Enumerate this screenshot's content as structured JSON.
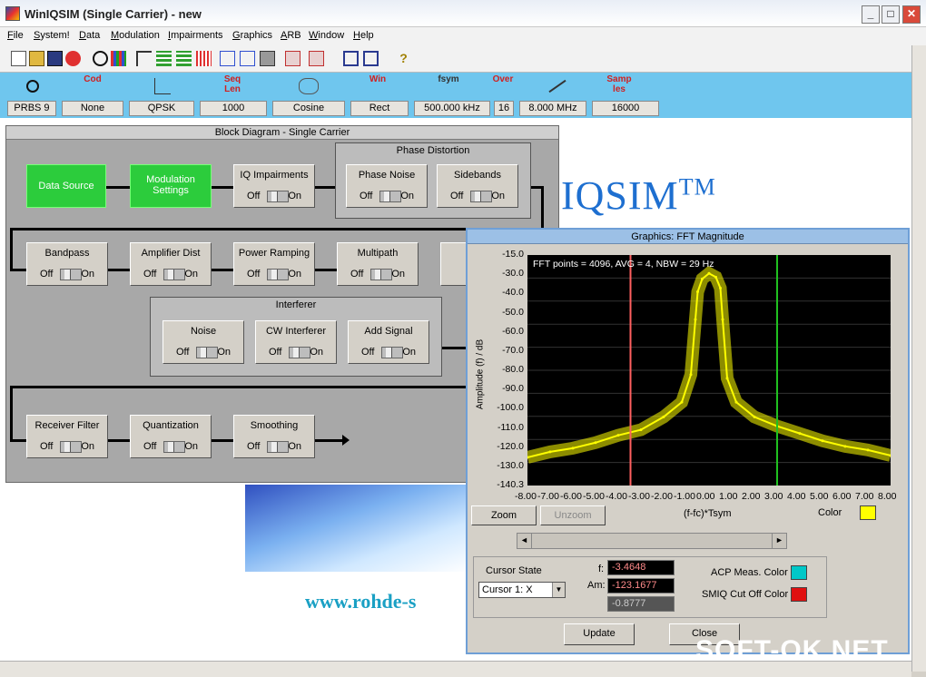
{
  "window": {
    "title": "WinIQSIM (Single Carrier) - new",
    "controls": [
      "_",
      "□",
      "✕"
    ]
  },
  "menu": [
    "File",
    "System!",
    "Data",
    "Modulation",
    "Impairments",
    "Graphics",
    "ARB",
    "Window",
    "Help"
  ],
  "params": [
    {
      "icon": "data-source-icon",
      "label": "",
      "value": "PRBS 9"
    },
    {
      "icon": "coding-icon",
      "label": "Cod",
      "value": "None"
    },
    {
      "icon": "constellation-icon",
      "label": "",
      "value": "QPSK"
    },
    {
      "icon": "seq-len-icon",
      "label": "Seq Len",
      "value": "1000"
    },
    {
      "icon": "filter-icon",
      "label": "",
      "value": "Cosine"
    },
    {
      "icon": "window-icon",
      "label": "Win",
      "value": "Rect"
    },
    {
      "icon": "fsym-icon",
      "label": "fsym",
      "value": "500.000 kHz"
    },
    {
      "icon": "oversampling-icon",
      "label": "Over",
      "value": "16"
    },
    {
      "icon": "bandwidth-icon",
      "label": "",
      "value": "8.000 MHz"
    },
    {
      "icon": "samples-icon",
      "label": "Samp les",
      "value": "16000"
    }
  ],
  "block_diagram": {
    "title": "Block Diagram - Single Carrier",
    "switch_off": "Off",
    "switch_on": "On",
    "row1": {
      "data_source": "Data Source",
      "modulation": "Modulation Settings",
      "iq": "IQ Impairments"
    },
    "phase_group": {
      "title": "Phase Distortion",
      "phase_noise": "Phase Noise",
      "sidebands": "Sidebands"
    },
    "row2": {
      "bandpass": "Bandpass",
      "amplifier": "Amplifier Dist",
      "power_ramping": "Power Ramping",
      "multipath": "Multipath"
    },
    "interferer_group": {
      "title": "Interferer",
      "noise": "Noise",
      "cw": "CW Interferer",
      "add_signal": "Add Signal"
    },
    "row4": {
      "receiver": "Receiver Filter",
      "quantization": "Quantization",
      "smoothing": "Smoothing"
    }
  },
  "background": {
    "logo": "IQSIM",
    "tm": "TM",
    "url": "www.rohde-s"
  },
  "fft": {
    "title": "Graphics: FFT Magnitude",
    "info": "FFT points = 4096, AVG = 4, NBW = 29",
    "info_tail": "Hz",
    "ylabel": "Amplitude (f) / dB",
    "xlabel": "(f-fc)*Tsym",
    "yticks": [
      "-15.0",
      "-30.0",
      "-40.0",
      "-50.0",
      "-60.0",
      "-70.0",
      "-80.0",
      "-90.0",
      "-100.0",
      "-110.0",
      "-120.0",
      "-130.0",
      "-140.3"
    ],
    "xticks": [
      "-8.00",
      "-7.00",
      "-6.00",
      "-5.00",
      "-4.00",
      "-3.00",
      "-2.00",
      "-1.00",
      "0.00",
      "1.00",
      "2.00",
      "3.00",
      "4.00",
      "5.00",
      "6.00",
      "7.00",
      "8.00"
    ],
    "zoom": "Zoom",
    "unzoom": "Unzoom",
    "color_label": "Color",
    "trace_color": "#ffff00",
    "cursor_state_label": "Cursor State",
    "cursor_select": "Cursor 1: X",
    "f_label": "f:",
    "f_value": "-3.4648",
    "am_label": "Am:",
    "am_value": "-123.1677",
    "third_value": "-0.8777",
    "acp_label": "ACP Meas. Color",
    "acp_color": "#00c8c8",
    "smiq_label": "SMIQ Cut Off Color",
    "smiq_color": "#e01010",
    "update": "Update",
    "close": "Close"
  },
  "chart_data": {
    "type": "line",
    "title": "",
    "xlabel": "(f-fc)*Tsym",
    "ylabel": "Amplitude (f) / dB",
    "xlim": [
      -8.0,
      8.0
    ],
    "ylim": [
      -140.3,
      -15.0
    ],
    "cursors": [
      {
        "x": -3.46,
        "color": "#ff6060"
      },
      {
        "x": 3.0,
        "color": "#20c020"
      }
    ],
    "series": [
      {
        "x": [
          -8,
          -7,
          -6,
          -5,
          -4,
          -3,
          -2,
          -1.2,
          -0.8,
          -0.6,
          -0.5,
          -0.3,
          0,
          0.3,
          0.5,
          0.6,
          0.8,
          1.2,
          2,
          3,
          4,
          5,
          6,
          7,
          8
        ],
        "values": [
          -125,
          -122,
          -120,
          -117,
          -113,
          -110,
          -103,
          -95,
          -80,
          -50,
          -35,
          -28,
          -25,
          -27,
          -33,
          -50,
          -82,
          -95,
          -103,
          -108,
          -112,
          -116,
          -119,
          -121,
          -124
        ]
      }
    ]
  },
  "watermark": "SOFT-OK.NET"
}
